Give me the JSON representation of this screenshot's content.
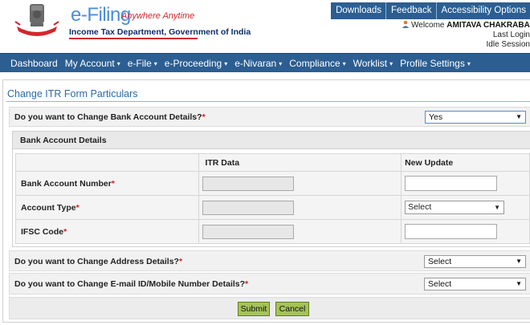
{
  "header": {
    "logo_title": "e-Filing",
    "logo_tagline": "Anywhere Anytime",
    "logo_department": "Income Tax Department, Government of India",
    "top_links": [
      "Downloads",
      "Feedback",
      "Accessibility Options"
    ],
    "welcome_prefix": "Welcome ",
    "user_name": "AMITAVA CHAKRABARTY",
    "last_login": "Last Login",
    "idle_session": "Idle Session"
  },
  "nav": {
    "items": [
      {
        "label": "Dashboard",
        "dropdown": false
      },
      {
        "label": "My Account",
        "dropdown": true
      },
      {
        "label": "e-File",
        "dropdown": true
      },
      {
        "label": "e-Proceeding",
        "dropdown": true
      },
      {
        "label": "e-Nivaran",
        "dropdown": true
      },
      {
        "label": "Compliance",
        "dropdown": true
      },
      {
        "label": "Worklist",
        "dropdown": true
      },
      {
        "label": "Profile Settings",
        "dropdown": true
      }
    ]
  },
  "form": {
    "title": "Change ITR Form Particulars",
    "bank_question": "Do you want to Change Bank Account Details?",
    "bank_answer": "Yes",
    "section_title": "Bank Account Details",
    "col_itr": "ITR Data",
    "col_new": "New Update",
    "rows": [
      {
        "label": "Bank Account Number"
      },
      {
        "label": "Account Type",
        "select_value": "Select"
      },
      {
        "label": "IFSC Code"
      }
    ],
    "address_question": "Do you want to Change Address Details?",
    "address_answer": "Select",
    "email_question": "Do you want to Change E-mail ID/Mobile Number Details?",
    "email_answer": "Select",
    "required_mark": "*",
    "submit_label": "Submit",
    "cancel_label": "Cancel"
  },
  "colors": {
    "nav_bg": "#2c5e92",
    "title_blue": "#2d6aa5",
    "button_green": "#a5c35a",
    "required_red": "#d01e1e"
  }
}
